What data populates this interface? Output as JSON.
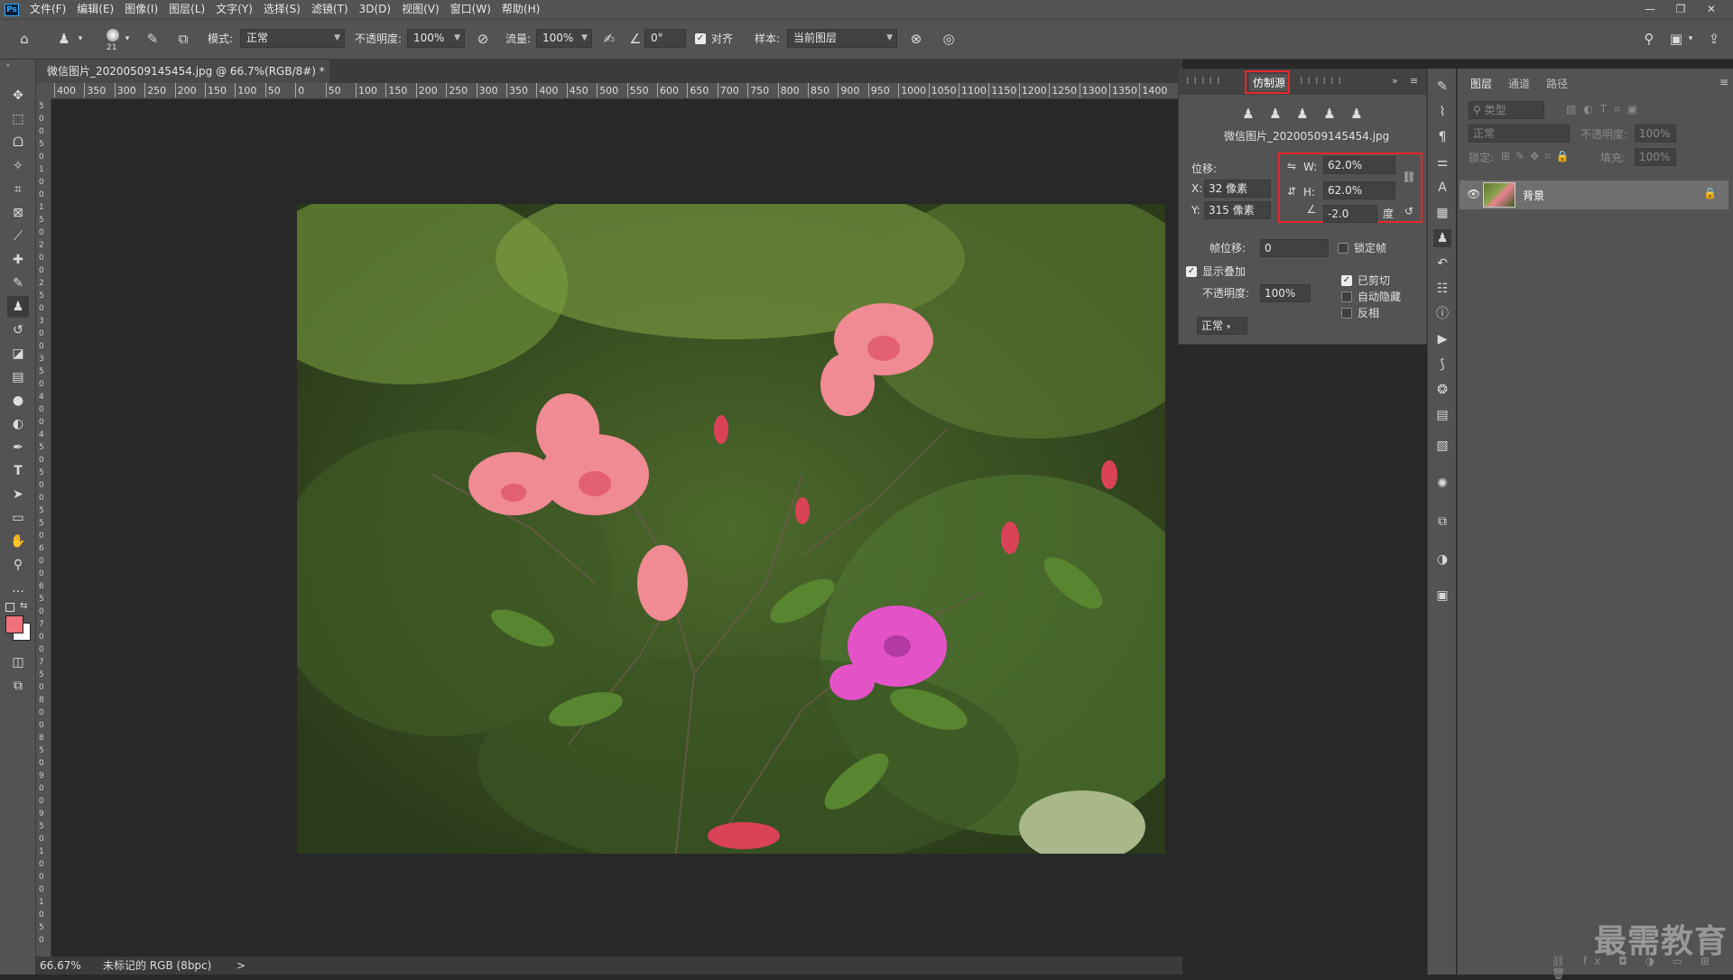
{
  "app": {
    "logo_text": "Ps"
  },
  "menu": [
    "文件(F)",
    "编辑(E)",
    "图像(I)",
    "图层(L)",
    "文字(Y)",
    "选择(S)",
    "滤镜(T)",
    "3D(D)",
    "视图(V)",
    "窗口(W)",
    "帮助(H)"
  ],
  "window_controls": {
    "minimize": "—",
    "restore": "❐",
    "close": "✕"
  },
  "options": {
    "brush_size": "21",
    "mode_label": "模式:",
    "mode_value": "正常",
    "opacity_label": "不透明度:",
    "opacity_value": "100%",
    "flow_label": "流量:",
    "flow_value": "100%",
    "angle_value": "0°",
    "aligned_label": "对齐",
    "sample_label": "样本:",
    "sample_value": "当前图层"
  },
  "document": {
    "tab_title": "微信图片_20200509145454.jpg @ 66.7%(RGB/8#) *",
    "close": "×"
  },
  "ruler_h": [
    "400",
    "350",
    "300",
    "250",
    "200",
    "150",
    "100",
    "50",
    "0",
    "50",
    "100",
    "150",
    "200",
    "250",
    "300",
    "350",
    "400",
    "450",
    "500",
    "550",
    "600",
    "650",
    "700",
    "750",
    "800",
    "850",
    "900",
    "950",
    "1000",
    "1050",
    "1100",
    "1150",
    "1200",
    "1250",
    "1300",
    "1350",
    "1400"
  ],
  "ruler_v": [
    "5",
    "0",
    "0",
    "5",
    "0",
    "1",
    "0",
    "0",
    "1",
    "5",
    "0",
    "2",
    "0",
    "0",
    "2",
    "5",
    "0",
    "3",
    "0",
    "0",
    "3",
    "5",
    "0",
    "4",
    "0",
    "0",
    "4",
    "5",
    "0",
    "5",
    "0",
    "0",
    "5",
    "5",
    "0",
    "6",
    "0",
    "0",
    "6",
    "5",
    "0",
    "7",
    "0",
    "0",
    "7",
    "5",
    "0",
    "8",
    "0",
    "0",
    "8",
    "5",
    "0",
    "9",
    "0",
    "0",
    "9",
    "5",
    "0",
    "1",
    "0",
    "0",
    "0",
    "1",
    "0",
    "5",
    "0"
  ],
  "status": {
    "zoom": "66.67%",
    "profile": "未标记的 RGB (8bpc)",
    "arrow": ">"
  },
  "clone_source": {
    "tab_active": "仿制源",
    "filename": "微信图片_20200509145454.jpg",
    "offset_label": "位移:",
    "x_label": "X:",
    "x_value": "32 像素",
    "y_label": "Y:",
    "y_value": "315 像素",
    "w_label": "W:",
    "w_value": "62.0%",
    "h_label": "H:",
    "h_value": "62.0%",
    "angle_value": "-2.0",
    "angle_unit": "度",
    "frame_offset_label": "帧位移:",
    "frame_offset_value": "0",
    "lock_frame_label": "锁定帧",
    "show_overlay_label": "显示叠加",
    "overlay_opacity_label": "不透明度:",
    "overlay_opacity_value": "100%",
    "overlay_mode": "正常",
    "clipped_label": "已剪切",
    "auto_hide_label": "自动隐藏",
    "invert_label": "反相"
  },
  "layers_panel": {
    "tabs": [
      "图层",
      "通道",
      "路径"
    ],
    "filter_placeholder": "类型",
    "blend_mode": "正常",
    "opacity_label": "不透明度:",
    "opacity_value": "100%",
    "lock_label": "锁定:",
    "fill_label": "填充:",
    "fill_value": "100%",
    "layer_name": "背景"
  },
  "watermark": "最需教育",
  "colors": {
    "foreground": "#f0707a",
    "background": "#ffffff",
    "highlight": "#e8262c"
  }
}
